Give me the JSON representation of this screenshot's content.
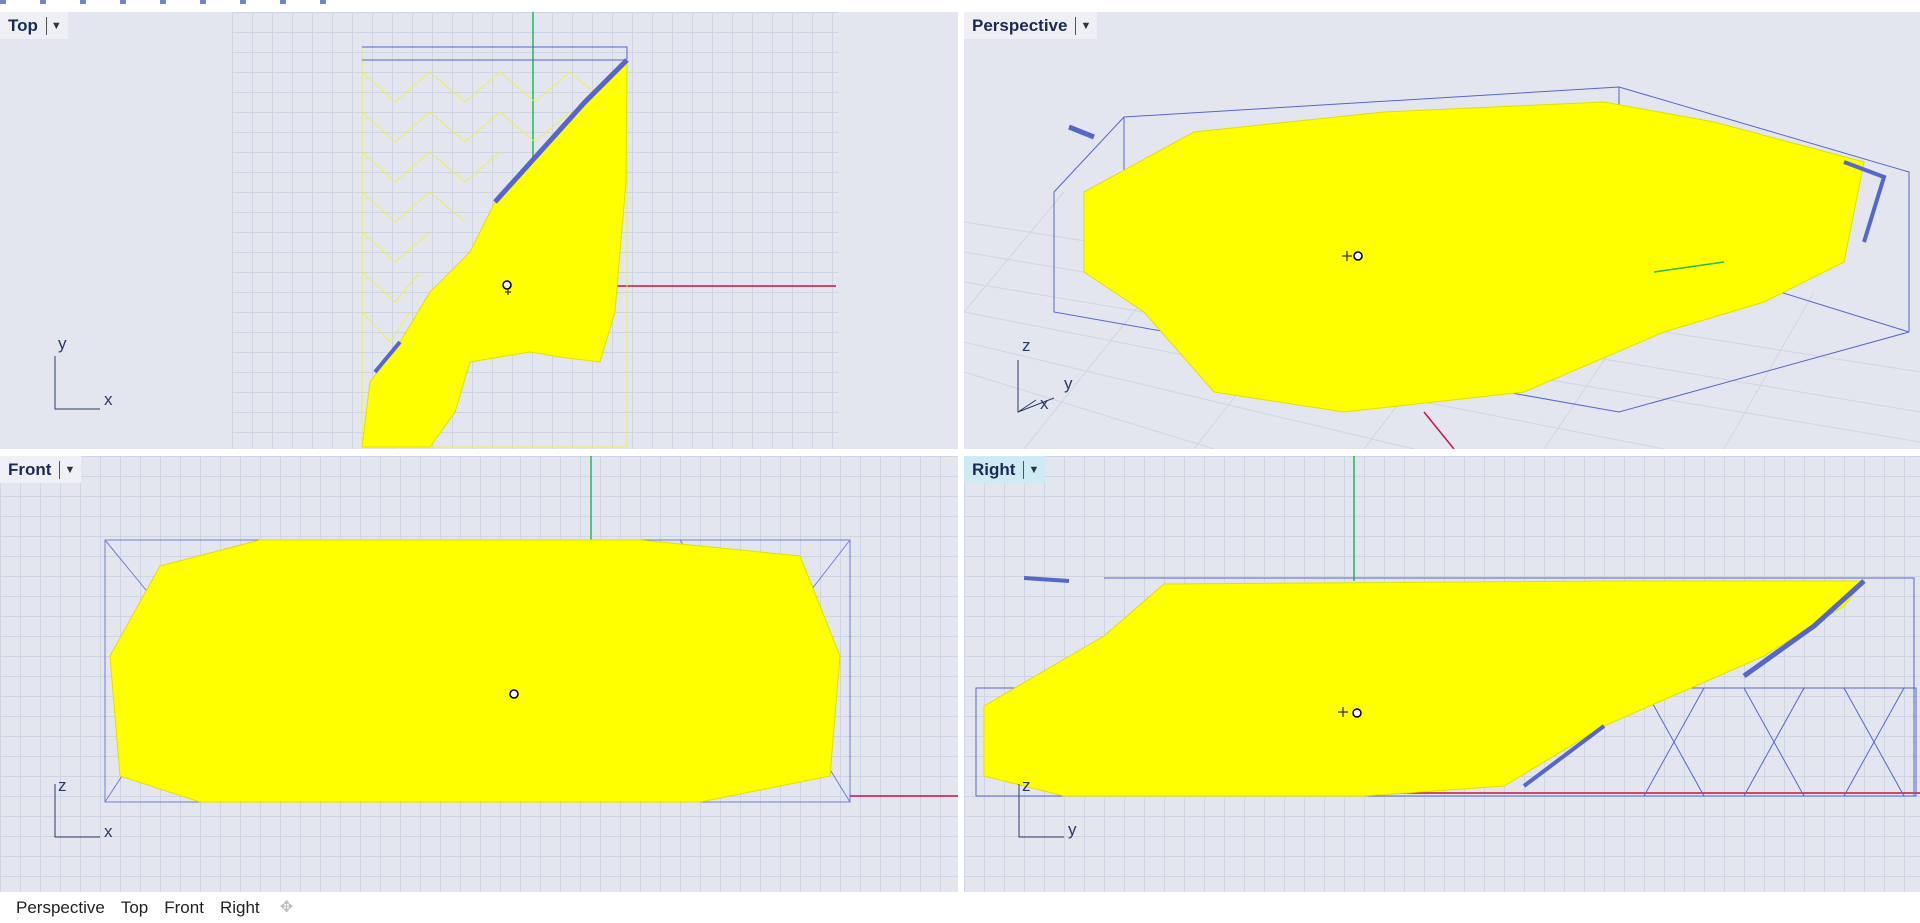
{
  "viewports": {
    "top": {
      "label": "Top",
      "axis_a": "y",
      "axis_b": "x"
    },
    "persp": {
      "label": "Perspective",
      "axis_a": "z",
      "axis_b": "y",
      "axis_c": "x"
    },
    "front": {
      "label": "Front",
      "axis_a": "z",
      "axis_b": "x"
    },
    "right": {
      "label": "Right",
      "axis_a": "z",
      "axis_b": "y",
      "active": true
    }
  },
  "tabs": [
    "Perspective",
    "Top",
    "Front",
    "Right"
  ],
  "colors": {
    "viewport_bg": "#e3e6ee",
    "mesh_yellow": "#ffff00",
    "wire_blue": "#5566cc",
    "axis_x_red": "#cc1144",
    "axis_y_green": "#22bb55",
    "active_label_bg": "#cdeaf5"
  },
  "icons": {
    "dropdown": "chevron-down-icon",
    "add_tab": "add-viewport-icon"
  }
}
